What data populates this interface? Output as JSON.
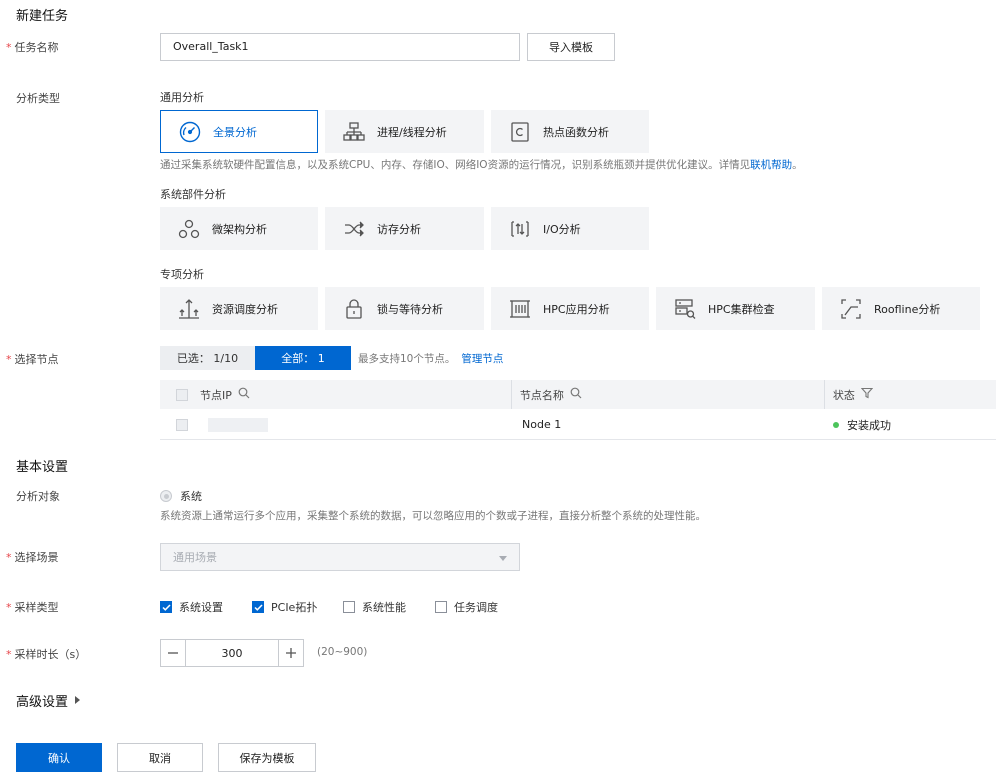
{
  "page": {
    "title": "新建任务"
  },
  "task_name": {
    "label": "任务名称",
    "value": "Overall_Task1",
    "import_button": "导入模板"
  },
  "analysis_type": {
    "label": "分析类型",
    "groups": [
      {
        "title": "通用分析",
        "items": [
          {
            "label": "全景分析",
            "icon": "gauge-icon",
            "active": true
          },
          {
            "label": "进程/线程分析",
            "icon": "process-tree-icon"
          },
          {
            "label": "热点函数分析",
            "icon": "function-c-icon"
          }
        ],
        "description": "通过采集系统软硬件配置信息，以及系统CPU、内存、存储IO、网络IO资源的运行情况，识别系统瓶颈并提供优化建议。详情见",
        "description_link": "联机帮助",
        "description_end": "。"
      },
      {
        "title": "系统部件分析",
        "items": [
          {
            "label": "微架构分析",
            "icon": "microarch-icon"
          },
          {
            "label": "访存分析",
            "icon": "memory-access-icon"
          },
          {
            "label": "I/O分析",
            "icon": "io-icon"
          }
        ]
      },
      {
        "title": "专项分析",
        "items": [
          {
            "label": "资源调度分析",
            "icon": "resource-schedule-icon"
          },
          {
            "label": "锁与等待分析",
            "icon": "lock-icon"
          },
          {
            "label": "HPC应用分析",
            "icon": "hpc-app-icon"
          },
          {
            "label": "HPC集群检查",
            "icon": "hpc-cluster-icon"
          },
          {
            "label": "Roofline分析",
            "icon": "roofline-icon"
          }
        ]
      }
    ]
  },
  "nodes": {
    "label": "选择节点",
    "tab_selected": "已选：  1/10",
    "tab_all": "全部：  1",
    "max_hint": "最多支持10个节点。",
    "manage_link": "管理节点",
    "columns": {
      "ip": "节点IP",
      "name": "节点名称",
      "status": "状态"
    },
    "rows": [
      {
        "ip": "",
        "name": "Node 1",
        "status": "安装成功"
      }
    ]
  },
  "basic": {
    "title": "基本设置",
    "target_label": "分析对象",
    "target_value": "系统",
    "target_hint": "系统资源上通常运行多个应用，采集整个系统的数据，可以忽略应用的个数或子进程，直接分析整个系统的处理性能。",
    "scene_label": "选择场景",
    "scene_placeholder": "通用场景",
    "sample_type_label": "采样类型",
    "sample_types": [
      {
        "label": "系统设置",
        "checked": true
      },
      {
        "label": "PCIe拓扑",
        "checked": true
      },
      {
        "label": "系统性能",
        "checked": false
      },
      {
        "label": "任务调度",
        "checked": false
      }
    ],
    "duration_label": "采样时长（s）",
    "duration_value": "300",
    "duration_range": "(20~900)"
  },
  "advanced": {
    "title": "高级设置"
  },
  "footer": {
    "confirm": "确认",
    "cancel": "取消",
    "save_template": "保存为模板"
  },
  "colors": {
    "accent": "#0067d1",
    "required": "#e6454a",
    "success": "#4cc45b"
  }
}
